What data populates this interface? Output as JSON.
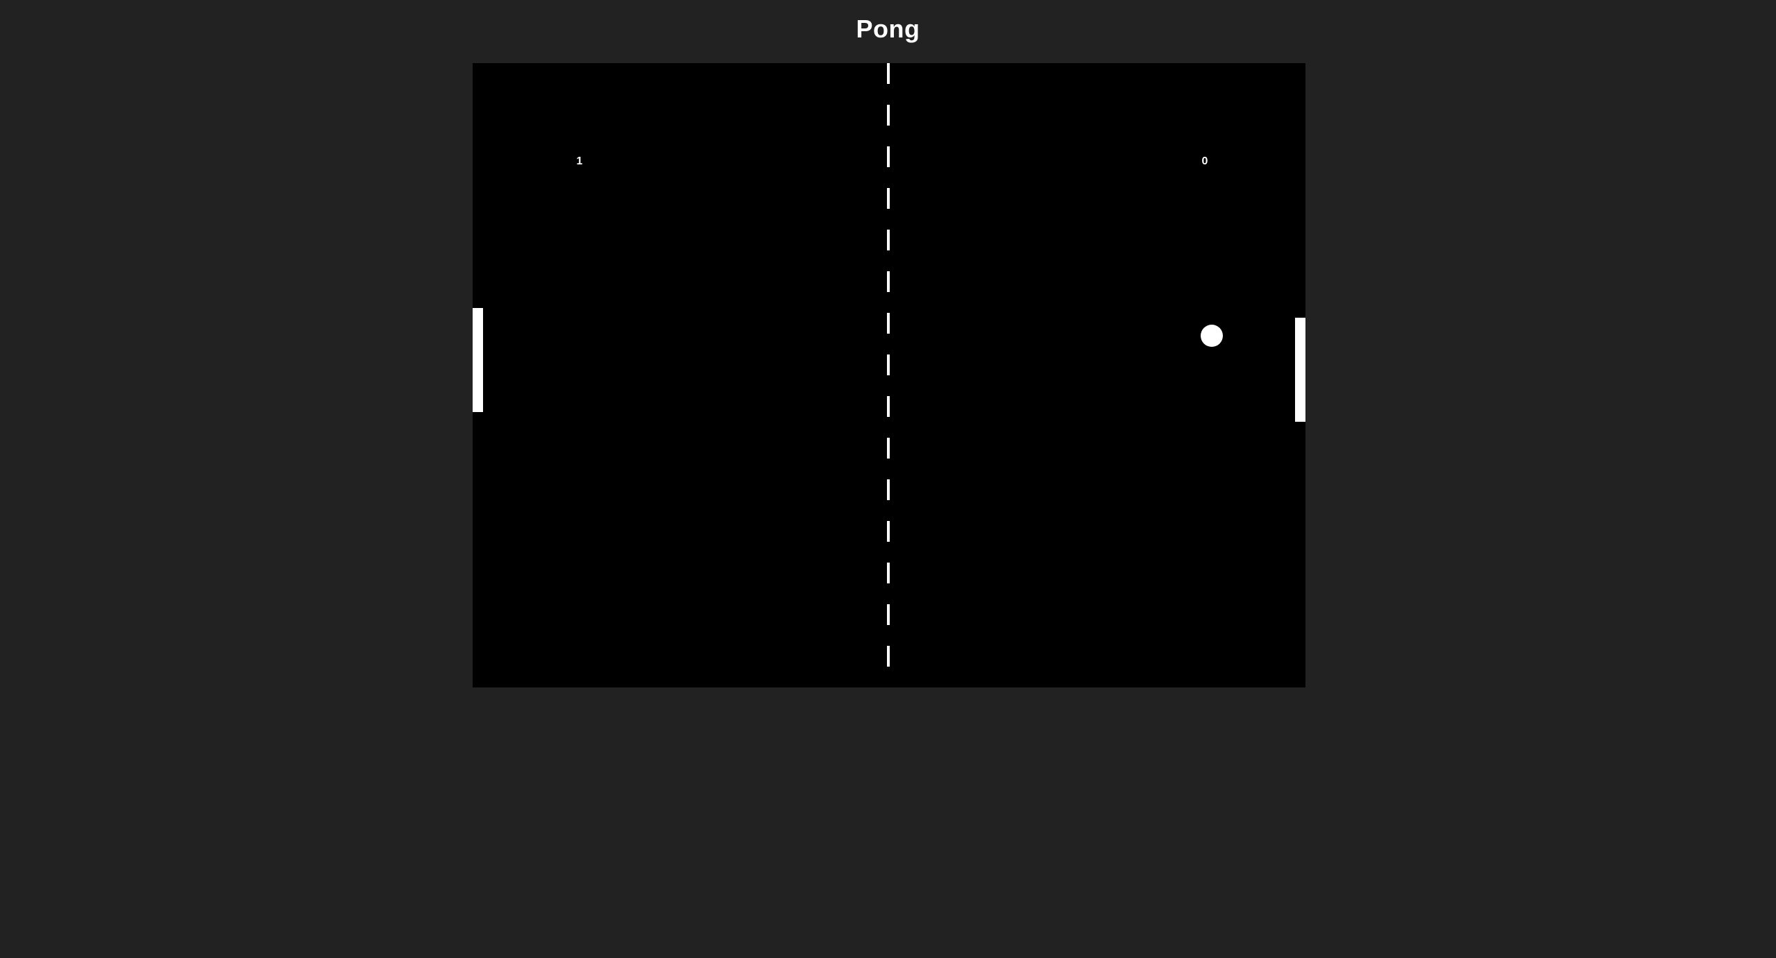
{
  "page": {
    "title": "Pong"
  },
  "game": {
    "score_left": "1",
    "score_right": "0",
    "colors": {
      "page_background": "#222222",
      "court_background": "#000000",
      "foreground": "#ffffff"
    }
  }
}
